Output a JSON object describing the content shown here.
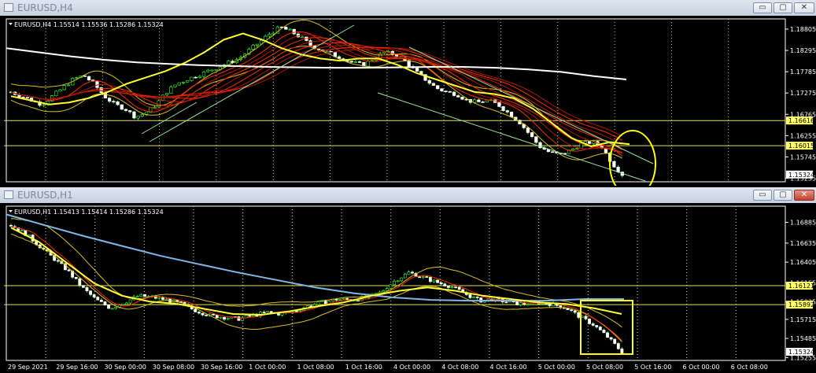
{
  "windows": [
    {
      "title": "EURUSD,H4",
      "controls": {
        "minimize": "▭",
        "maximize": "▢",
        "close": "✕"
      },
      "active": false
    },
    {
      "title": "EURUSD,H1",
      "controls": {
        "minimize": "▭",
        "maximize": "▢",
        "close": "✕"
      },
      "active": true
    }
  ],
  "colors": {
    "candle": "#33ff33",
    "yellow_ma": "#ffff33",
    "white_ma": "#ffffff",
    "blue_ma": "#7fb8e8",
    "red_ma": "#ff2a00",
    "band": "#d8c018",
    "level_line": "#e0e060",
    "highlight": "#ffff00"
  },
  "chart_data": [
    {
      "type": "candlestick",
      "symbol_header": "EURUSD,H4  1.15514 1.15536 1.15286 1.15324",
      "ylim": [
        1.1515,
        1.1905
      ],
      "yticks": [
        "1.18805",
        "1.18295",
        "1.17785",
        "1.17275",
        "1.16765",
        "1.16255",
        "1.15745",
        "1.15235"
      ],
      "ytick_values": [
        1.18805,
        1.18295,
        1.17785,
        1.17275,
        1.16765,
        1.16255,
        1.15745,
        1.15235
      ],
      "levels": [
        {
          "label": "1.16616",
          "value": 1.16616
        },
        {
          "label": "1.16015",
          "value": 1.16015
        }
      ],
      "last_price": {
        "label": "1.15324",
        "value": 1.15324
      },
      "close_path": [
        1.173,
        1.172,
        1.171,
        1.17,
        1.172,
        1.174,
        1.176,
        1.177,
        1.175,
        1.172,
        1.17,
        1.169,
        1.167,
        1.168,
        1.17,
        1.173,
        1.175,
        1.176,
        1.177,
        1.178,
        1.179,
        1.18,
        1.181,
        1.183,
        1.185,
        1.187,
        1.1885,
        1.1875,
        1.186,
        1.184,
        1.183,
        1.182,
        1.181,
        1.18,
        1.1795,
        1.181,
        1.1825,
        1.182,
        1.1805,
        1.178,
        1.176,
        1.174,
        1.173,
        1.1725,
        1.171,
        1.1705,
        1.171,
        1.17,
        1.168,
        1.166,
        1.163,
        1.16,
        1.1585,
        1.158,
        1.159,
        1.1605,
        1.161,
        1.16,
        1.156,
        1.15324
      ],
      "white_ma": [
        1.1835,
        1.1825,
        1.1815,
        1.1807,
        1.1801,
        1.1797,
        1.1794,
        1.1792,
        1.179,
        1.1789,
        1.1788,
        1.1788,
        1.1789,
        1.179,
        1.179,
        1.1788,
        1.1784,
        1.1778,
        1.1768,
        1.176
      ],
      "yellow_ma": [
        1.172,
        1.171,
        1.17,
        1.1705,
        1.1715,
        1.173,
        1.175,
        1.1765,
        1.178,
        1.18,
        1.1825,
        1.1855,
        1.187,
        1.1855,
        1.1835,
        1.182,
        1.181,
        1.1805,
        1.181,
        1.181,
        1.1795,
        1.1775,
        1.176,
        1.1745,
        1.173,
        1.1725,
        1.1715,
        1.169,
        1.1655,
        1.162,
        1.16,
        1.161,
        1.1605
      ]
    },
    {
      "type": "candlestick",
      "symbol_header": "EURUSD,H1  1.15413 1.15414 1.15286 1.15324",
      "ylim": [
        1.1522,
        1.1708
      ],
      "yticks": [
        "1.16885",
        "1.16635",
        "1.16405",
        "1.16155",
        "1.15925",
        "1.15715",
        "1.15485",
        "1.15255"
      ],
      "ytick_values": [
        1.16885,
        1.16635,
        1.16405,
        1.16155,
        1.15925,
        1.15715,
        1.15485,
        1.15255
      ],
      "levels": [
        {
          "label": "1.16121",
          "value": 1.16121
        },
        {
          "label": "1.15892",
          "value": 1.15892
        }
      ],
      "last_price": {
        "label": "1.15324",
        "value": 1.15324
      },
      "xtick_labels": [
        "29 Sep 2021",
        "29 Sep 16:00",
        "30 Sep 00:00",
        "30 Sep 08:00",
        "30 Sep 16:00",
        "1 Oct 00:00",
        "1 Oct 08:00",
        "1 Oct 16:00",
        "4 Oct 00:00",
        "4 Oct 08:00",
        "4 Oct 16:00",
        "5 Oct 00:00",
        "5 Oct 08:00",
        "5 Oct 16:00",
        "6 Oct 00:00",
        "6 Oct 08:00"
      ],
      "close_path": [
        1.1685,
        1.1675,
        1.166,
        1.1645,
        1.163,
        1.161,
        1.1595,
        1.1585,
        1.1592,
        1.16,
        1.1598,
        1.1595,
        1.159,
        1.1582,
        1.1576,
        1.1574,
        1.1572,
        1.1576,
        1.158,
        1.1578,
        1.1582,
        1.1588,
        1.1592,
        1.1596,
        1.1595,
        1.1598,
        1.1604,
        1.1618,
        1.1628,
        1.1622,
        1.1616,
        1.1611,
        1.1602,
        1.1594,
        1.1596,
        1.1592,
        1.159,
        1.1592,
        1.159,
        1.1586,
        1.1575,
        1.1565,
        1.155,
        1.1532
      ],
      "blue_ma": [
        1.1698,
        1.1685,
        1.1672,
        1.166,
        1.1648,
        1.1638,
        1.1628,
        1.1619,
        1.161,
        1.1603,
        1.1598,
        1.1595,
        1.1594,
        1.1594,
        1.1594,
        1.1596,
        1.1596
      ],
      "yellow_ma": [
        1.1682,
        1.1665,
        1.164,
        1.1615,
        1.16,
        1.1593,
        1.159,
        1.1584,
        1.1578,
        1.1577,
        1.1581,
        1.1587,
        1.1592,
        1.16,
        1.1606,
        1.161,
        1.1606,
        1.16,
        1.1596,
        1.1592,
        1.159,
        1.1585,
        1.1578
      ]
    }
  ]
}
